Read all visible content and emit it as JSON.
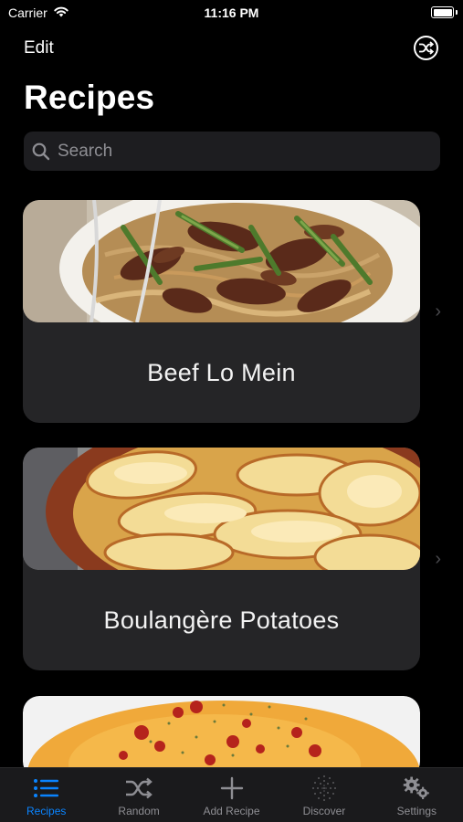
{
  "status_bar": {
    "carrier": "Carrier",
    "time": "11:16 PM"
  },
  "nav": {
    "edit_label": "Edit",
    "title": "Recipes"
  },
  "search": {
    "placeholder": "Search"
  },
  "recipes": [
    {
      "title": "Beef Lo Mein"
    },
    {
      "title": "Boulangère Potatoes"
    },
    {
      "title": ""
    }
  ],
  "tabs": [
    {
      "label": "Recipes",
      "icon": "list-icon",
      "active": true
    },
    {
      "label": "Random",
      "icon": "shuffle-icon",
      "active": false
    },
    {
      "label": "Add Recipe",
      "icon": "plus-icon",
      "active": false
    },
    {
      "label": "Discover",
      "icon": "discover-icon",
      "active": false
    },
    {
      "label": "Settings",
      "icon": "gears-icon",
      "active": false
    }
  ],
  "colors": {
    "accent": "#0a84ff",
    "card": "#252527",
    "background": "#000000",
    "inactive": "#8e8e93"
  }
}
